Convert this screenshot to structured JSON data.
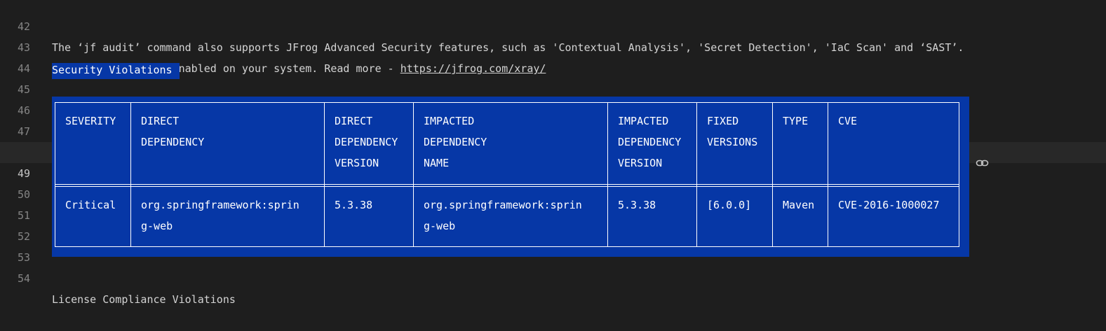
{
  "editor": {
    "lines": [
      {
        "num": "42",
        "text": "The ‘jf audit’ command also supports JFrog Advanced Security features, such as 'Contextual Analysis', 'Secret Detection', 'IaC Scan' and ‘SAST’."
      },
      {
        "num": "43",
        "text_before": "This feature isn't enabled on your system. Read more - ",
        "link": "https://jfrog.com/xray/"
      },
      {
        "num": "44",
        "text": ""
      },
      {
        "num": "45",
        "text": "Security Violations"
      },
      {
        "num": "46",
        "text": ""
      },
      {
        "num": "47",
        "text": ""
      },
      {
        "num": "48",
        "text": ""
      },
      {
        "num": "49",
        "text": ""
      },
      {
        "num": "50",
        "text": ""
      },
      {
        "num": "51",
        "text": ""
      },
      {
        "num": "52",
        "text": ""
      },
      {
        "num": "53",
        "text": ""
      },
      {
        "num": "54",
        "text": "License Compliance Violations"
      }
    ]
  },
  "table": {
    "headers": [
      [
        "SEVERITY"
      ],
      [
        "DIRECT",
        "DEPENDENCY"
      ],
      [
        "DIRECT",
        "DEPENDENCY",
        "VERSION"
      ],
      [
        "IMPACTED",
        "DEPENDENCY",
        "NAME"
      ],
      [
        "IMPACTED",
        "DEPENDENCY",
        "VERSION"
      ],
      [
        "FIXED",
        "VERSIONS"
      ],
      [
        "TYPE"
      ],
      [
        "CVE"
      ]
    ],
    "rows": [
      [
        [
          "Critical"
        ],
        [
          "org.springframework:sprin",
          "g-web"
        ],
        [
          "5.3.38"
        ],
        [
          "org.springframework:sprin",
          "g-web"
        ],
        [
          "5.3.38"
        ],
        [
          "[6.0.0]"
        ],
        [
          "Maven"
        ],
        [
          "CVE-2016-1000027"
        ]
      ]
    ]
  },
  "icons": {
    "line_49_action": "link-icon"
  },
  "colors": {
    "background": "#1e1e1e",
    "selection": "#0637a6",
    "line_number": "#858585"
  }
}
